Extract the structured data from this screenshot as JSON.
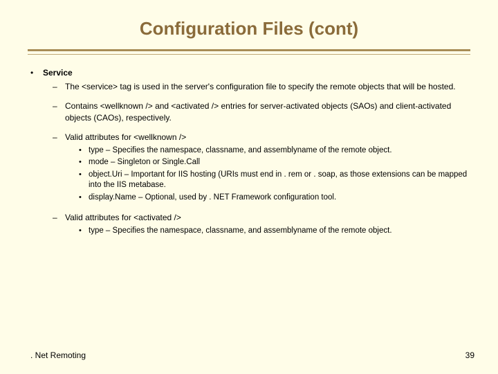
{
  "title": "Configuration Files (cont)",
  "service": {
    "heading": "Service",
    "points": [
      "The <service> tag is used in the server's configuration file to specify the remote objects that will be hosted.",
      "Contains <wellknown /> and <activated /> entries for server-activated objects (SAOs) and client-activated objects (CAOs), respectively.",
      "Valid attributes for <wellknown />",
      "Valid attributes for <activated />"
    ],
    "wellknown_attrs": [
      "type – Specifies the namespace, classname, and assemblyname of the remote object.",
      "mode – Singleton or Single.Call",
      "object.Uri – Important for IIS hosting (URIs must end in . rem or . soap, as those extensions can be mapped into the IIS metabase.",
      "display.Name – Optional, used by . NET Framework configuration tool."
    ],
    "activated_attrs": [
      "type – Specifies the namespace, classname, and assemblyname of the remote object."
    ]
  },
  "footer": {
    "left": ". Net Remoting",
    "right": "39"
  }
}
